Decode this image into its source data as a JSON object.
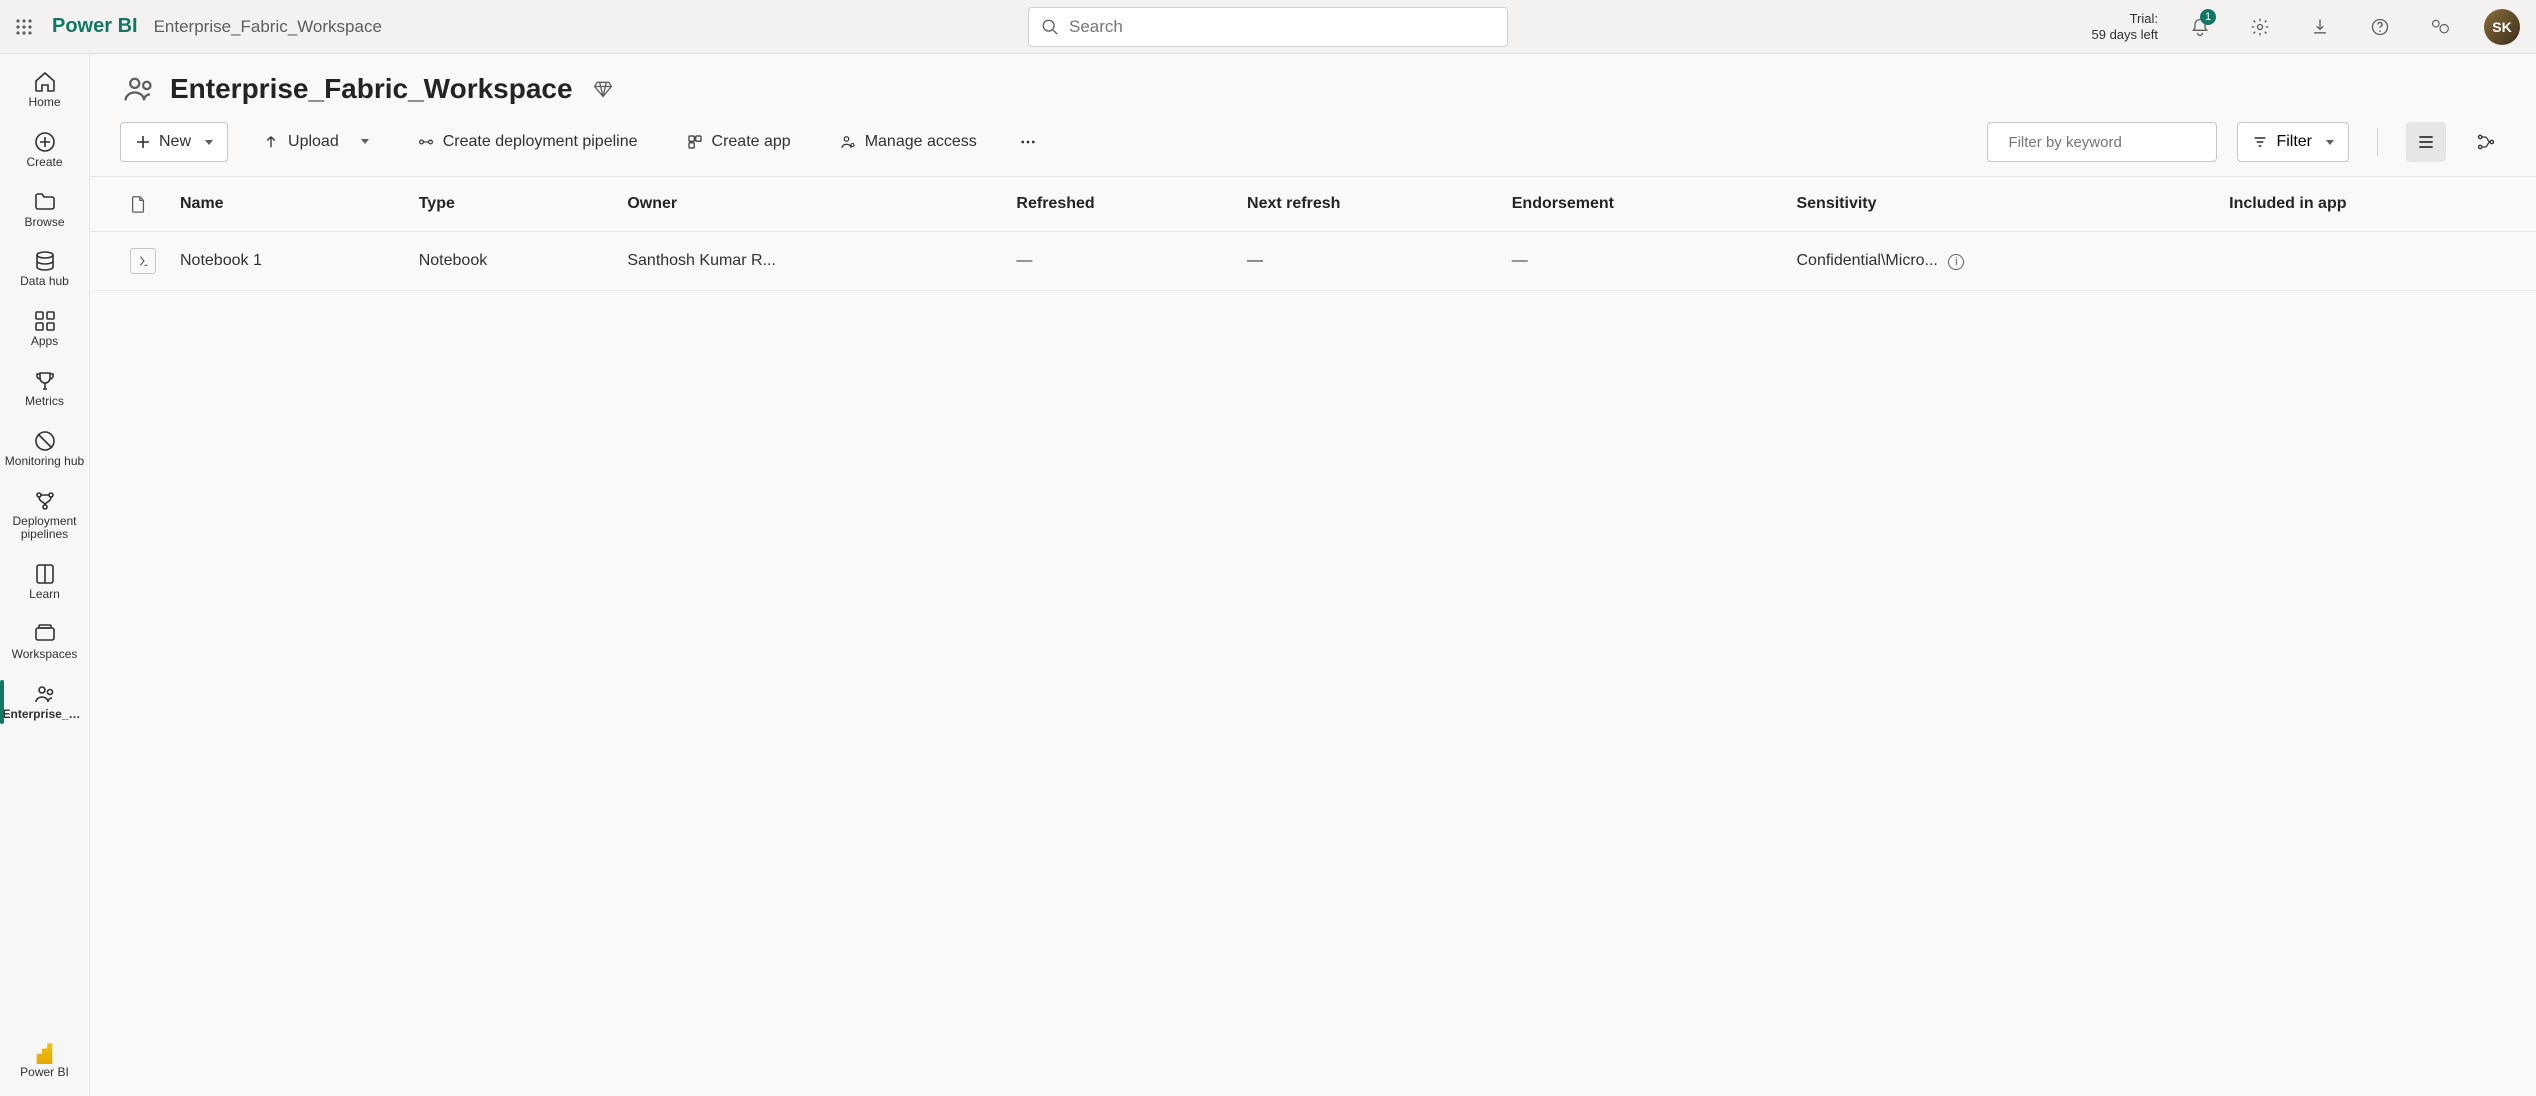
{
  "header": {
    "brand": "Power BI",
    "breadcrumb": "Enterprise_Fabric_Workspace",
    "search_placeholder": "Search",
    "trial_label": "Trial:",
    "trial_remaining": "59 days left",
    "notification_count": "1"
  },
  "sidebar": {
    "items": [
      {
        "label": "Home"
      },
      {
        "label": "Create"
      },
      {
        "label": "Browse"
      },
      {
        "label": "Data hub"
      },
      {
        "label": "Apps"
      },
      {
        "label": "Metrics"
      },
      {
        "label": "Monitoring hub"
      },
      {
        "label": "Deployment pipelines"
      },
      {
        "label": "Learn"
      },
      {
        "label": "Workspaces"
      },
      {
        "label": "Enterprise_Fabric_Wor..."
      }
    ],
    "bottom_label": "Power BI"
  },
  "page": {
    "title": "Enterprise_Fabric_Workspace"
  },
  "toolbar": {
    "new": "New",
    "upload": "Upload",
    "create_pipeline": "Create deployment pipeline",
    "create_app": "Create app",
    "manage_access": "Manage access",
    "filter_placeholder": "Filter by keyword",
    "filter_label": "Filter"
  },
  "table": {
    "columns": [
      "",
      "Name",
      "Type",
      "Owner",
      "Refreshed",
      "Next refresh",
      "Endorsement",
      "Sensitivity",
      "Included in app"
    ],
    "rows": [
      {
        "name": "Notebook 1",
        "type": "Notebook",
        "owner": "Santhosh Kumar R...",
        "refreshed": "—",
        "next_refresh": "—",
        "endorsement": "—",
        "sensitivity": "Confidential\\Micro...",
        "included": ""
      }
    ]
  }
}
